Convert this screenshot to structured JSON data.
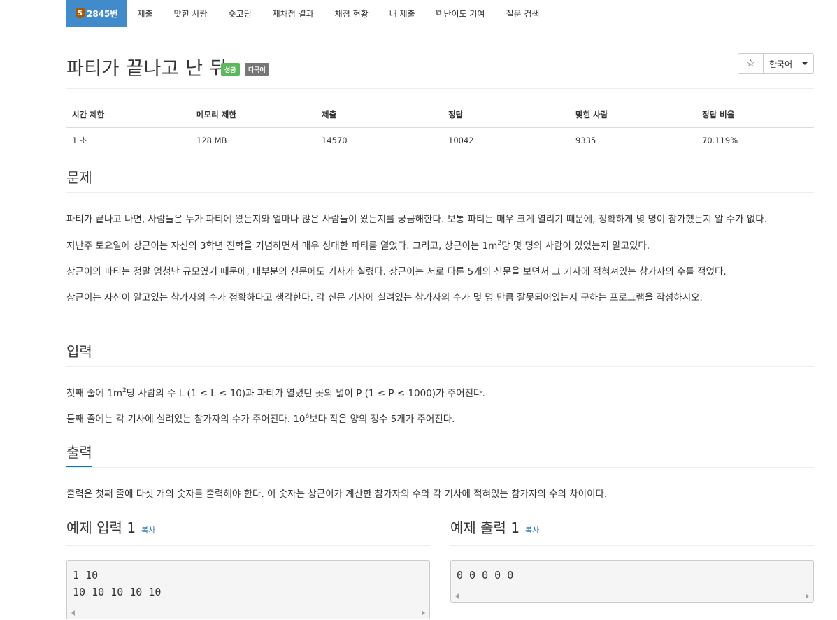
{
  "nav": {
    "tier_level": "5",
    "problem_number": "2845번",
    "items": [
      "제출",
      "맞힌 사람",
      "숏코딩",
      "재채점 결과",
      "채점 현황",
      "내 제출",
      "난이도 기여",
      "질문 검색"
    ]
  },
  "title": "파티가 끝나고 난 뒤",
  "labels": {
    "success": "성공",
    "multilang": "다국어"
  },
  "controls": {
    "star": "☆",
    "language": "한국어"
  },
  "info": {
    "headers": [
      "시간 제한",
      "메모리 제한",
      "제출",
      "정답",
      "맞힌 사람",
      "정답 비율"
    ],
    "values": [
      "1 초",
      "128 MB",
      "14570",
      "10042",
      "9335",
      "70.119%"
    ]
  },
  "sections": {
    "problem": "문제",
    "input": "입력",
    "output": "출력"
  },
  "problem": {
    "p1": "파티가 끝나고 나면, 사람들은 누가 파티에 왔는지와 얼마나 많은 사람들이 왔는지를 궁금해한다. 보통 파티는 매우 크게 열리기 때문에, 정확하게 몇 명이 참가했는지 알 수가 없다.",
    "p2_a": "지난주 토요일에 상근이는 자신의 3학년 진학을 기념하면서 매우 성대한 파티를 열었다. 그리고, 상근이는 1m",
    "p2_sup": "2",
    "p2_b": "당 몇 명의 사람이 있었는지 알고있다.",
    "p3": "상근이의 파티는 정말 엄청난 규모였기 때문에, 대부분의 신문에도 기사가 실렸다. 상근이는 서로 다른 5개의 신문을 보면서 그 기사에 적혀져있는 참가자의 수를 적었다.",
    "p4": "상근이는 자신이 알고있는 참가자의 수가 정확하다고 생각한다. 각 신문 기사에 실려있는 참가자의 수가 몇 명 만큼 잘못되어있는지 구하는 프로그램을 작성하시오."
  },
  "input": {
    "l1_a": "첫째 줄에 1m",
    "l1_sup": "2",
    "l1_b": "당 사람의 수 L (1 ≤ L ≤ 10)과 파티가 열렸던 곳의 넓이 P (1 ≤ P ≤ 1000)가 주어진다.",
    "l2_a": "둘째 줄에는 각 기사에 실려있는 참가자의 수가 주어진다. 10",
    "l2_sup": "6",
    "l2_b": "보다 작은 양의 정수 5개가 주어진다."
  },
  "output": {
    "text": "출력은 첫째 줄에 다섯 개의 숫자를 출력해야 한다. 이 숫자는 상근이가 계산한 참가자의 수와  각 기사에 적혀있는 참가자의 수의 차이이다."
  },
  "samples": {
    "input_title": "예제 입력 1",
    "output_title": "예제 출력 1",
    "copy": "복사",
    "input_lines": "1 10\n10 10 10 10 10",
    "output_lines": "0 0 0 0 0"
  }
}
